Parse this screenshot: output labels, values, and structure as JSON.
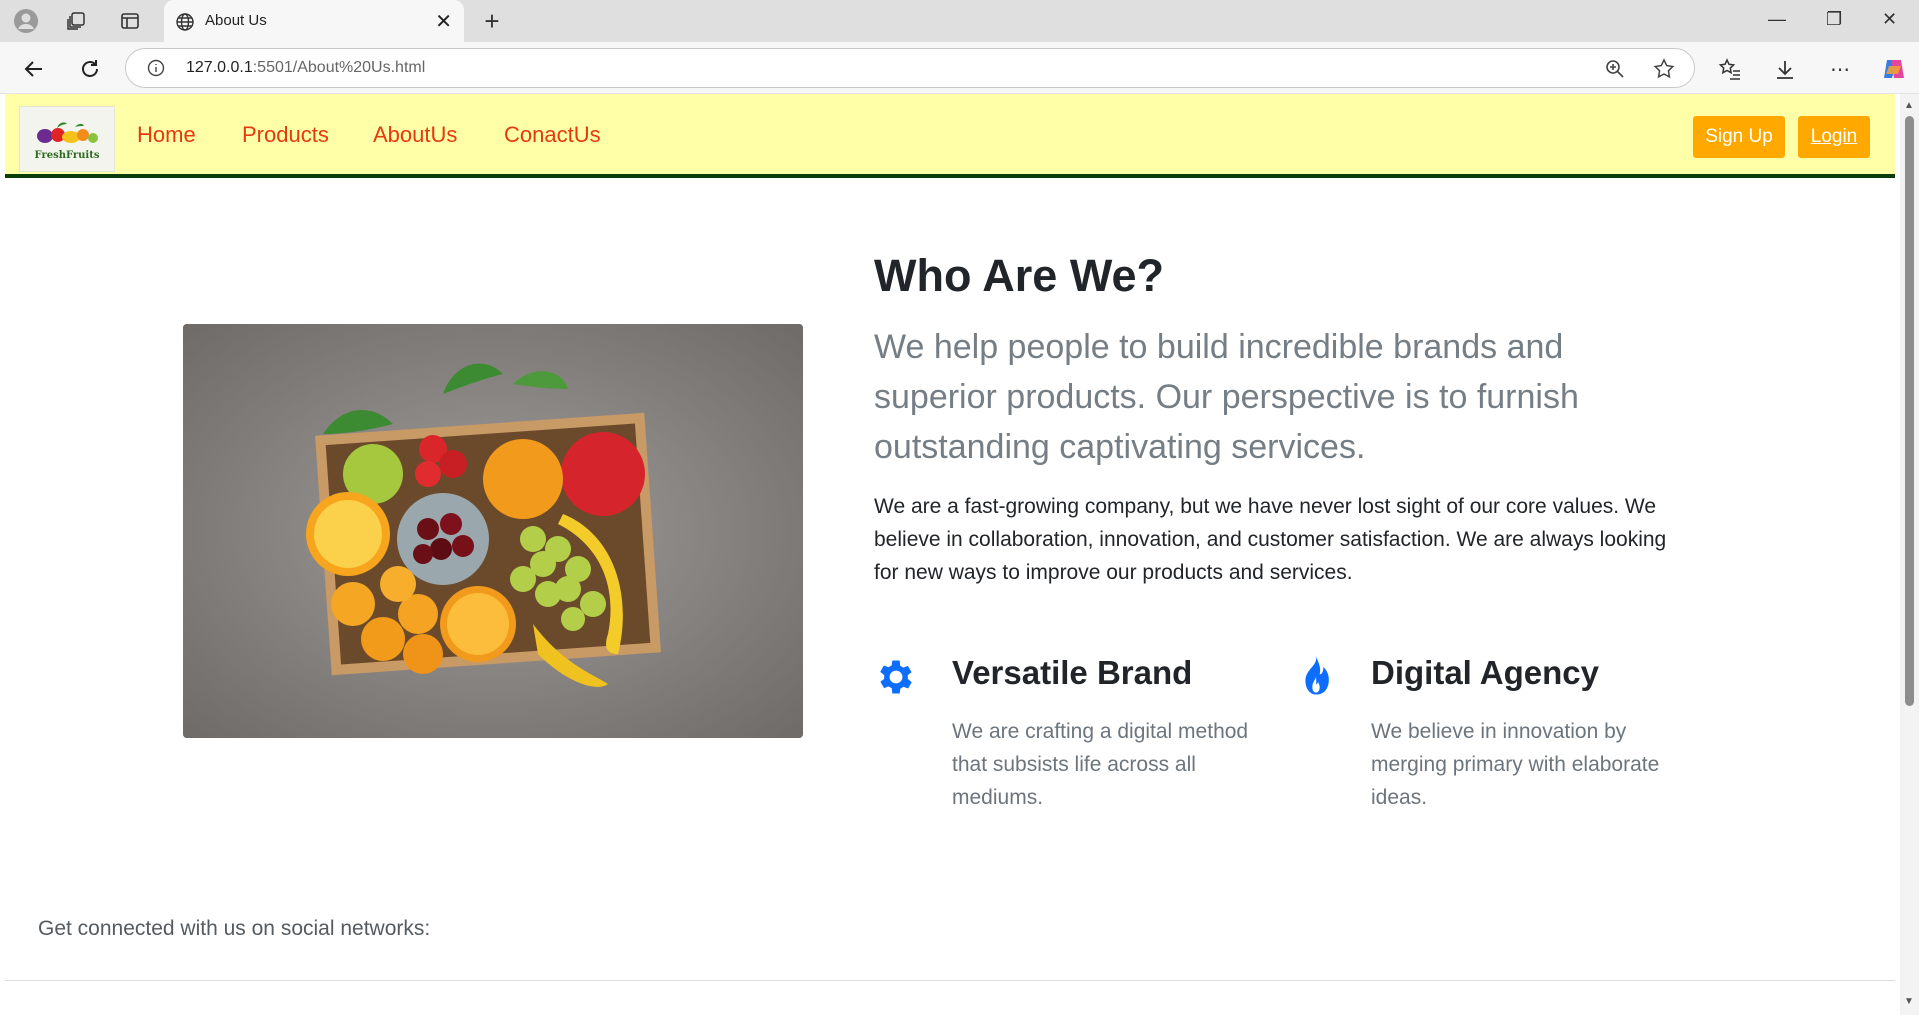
{
  "browser": {
    "tab_title": "About Us",
    "url_host": "127.0.0.1",
    "url_path": ":5501/About%20Us.html"
  },
  "navbar": {
    "logo_text": "FreshFruits",
    "links": [
      "Home",
      "Products",
      "AboutUs",
      "ConactUs"
    ],
    "signup_label": "Sign Up",
    "login_label": "Login"
  },
  "about": {
    "heading": "Who Are We?",
    "lead": "We help people to build incredible brands and superior products. Our perspective is to furnish outstanding captivating services.",
    "paragraph": "We are a fast-growing company, but we have never lost sight of our core values. We believe in collaboration, innovation, and customer satisfaction. We are always looking for new ways to improve our products and services.",
    "features": [
      {
        "title": "Versatile Brand",
        "text": "We are crafting a digital method that subsists life across all mediums.",
        "icon": "gear-icon"
      },
      {
        "title": "Digital Agency",
        "text": "We believe in innovation by merging primary with elaborate ideas.",
        "icon": "fire-icon"
      }
    ]
  },
  "footer": {
    "social_text": "Get connected with us on social networks:"
  },
  "colors": {
    "navbar_bg": "#ffffa8",
    "nav_link": "#e53a0f",
    "button_bg": "#ffa900",
    "icon_blue": "#0d6efd",
    "navbar_border": "#0b3d0b"
  }
}
